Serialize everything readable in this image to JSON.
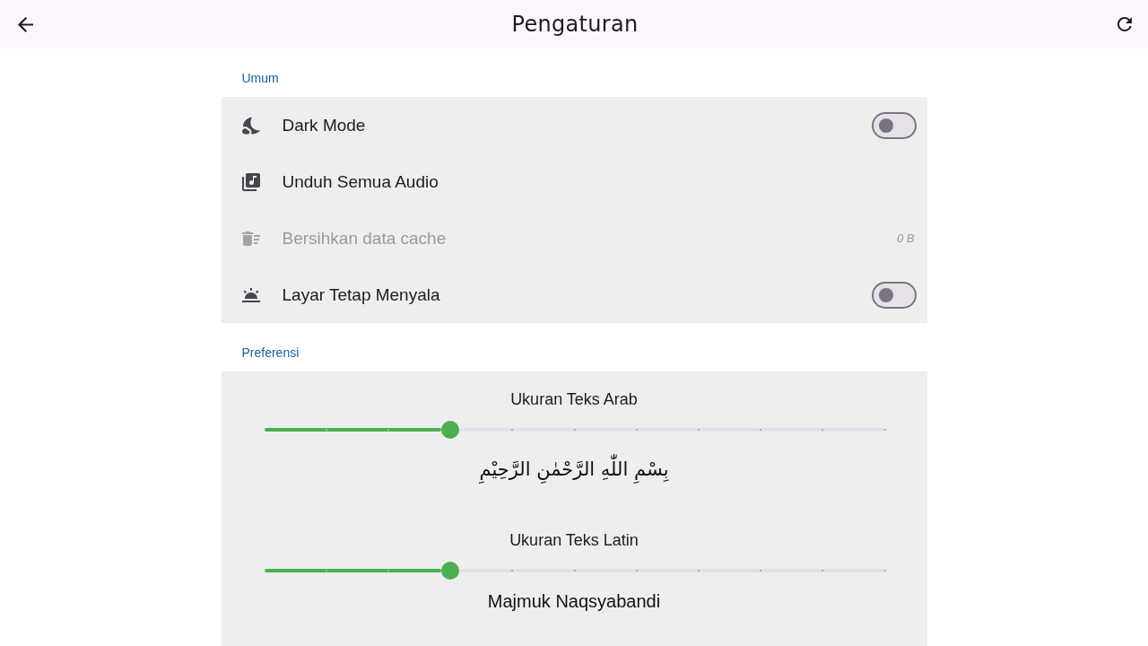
{
  "app_bar": {
    "title": "Pengaturan"
  },
  "sections": [
    {
      "title": "Umum",
      "items": [
        {
          "kind": "toggle",
          "label": "Dark Mode",
          "on": false,
          "disabled": false
        },
        {
          "kind": "action",
          "label": "Unduh Semua Audio",
          "disabled": false
        },
        {
          "kind": "value",
          "label": "Bersihkan data cache",
          "value": "0 B",
          "disabled": true
        },
        {
          "kind": "toggle",
          "label": "Layar Tetap Menyala",
          "on": false,
          "disabled": false
        }
      ]
    },
    {
      "title": "Preferensi",
      "sliders": [
        {
          "kind": "arabic",
          "label": "Ukuran Teks Arab",
          "level": 0.3,
          "preview": "بِسْمِ اللّٰهِ الرَّحْمٰنِ الرَّحِيْمِ"
        },
        {
          "kind": "latin",
          "label": "Ukuran Teks Latin",
          "level": 0.3,
          "preview": "Majmuk Naqsyabandi"
        }
      ]
    }
  ]
}
